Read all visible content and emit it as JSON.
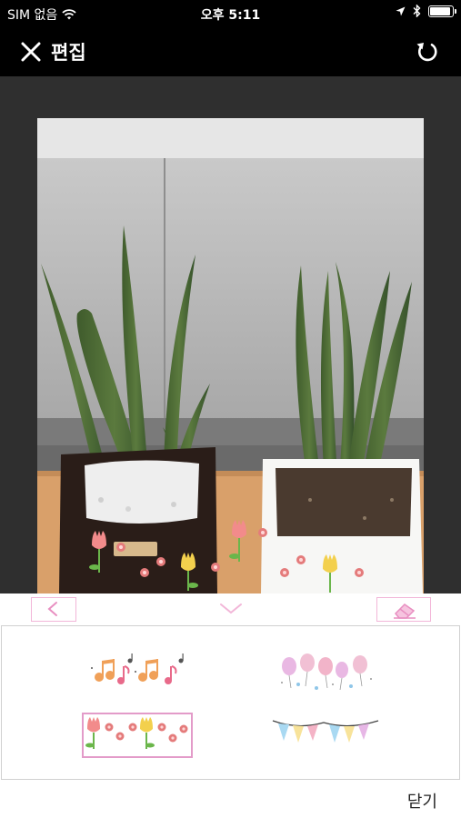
{
  "status_bar": {
    "carrier": "SIM 없음",
    "time": "오후 5:11",
    "icons": [
      "wifi-icon",
      "location-arrow-icon",
      "bluetooth-icon",
      "battery-icon"
    ],
    "battery_level": 0.95
  },
  "nav": {
    "title": "편집",
    "close_icon": "close-icon",
    "undo_icon": "undo-icon"
  },
  "controls": {
    "prev_icon": "chevron-left-icon",
    "collapse_icon": "chevron-down-icon",
    "eraser_icon": "eraser-icon"
  },
  "stickers": [
    {
      "name": "music-notes",
      "selected": false
    },
    {
      "name": "balloons",
      "selected": false
    },
    {
      "name": "tulips-flowers",
      "selected": true
    },
    {
      "name": "bunting-flags",
      "selected": false
    }
  ],
  "footer": {
    "close_label": "닫기"
  },
  "colors": {
    "bar_background": "#000000",
    "canvas_background": "#2f2f2f",
    "accent_pink": "#f2b6d8",
    "selected_border": "#e39bc9"
  }
}
